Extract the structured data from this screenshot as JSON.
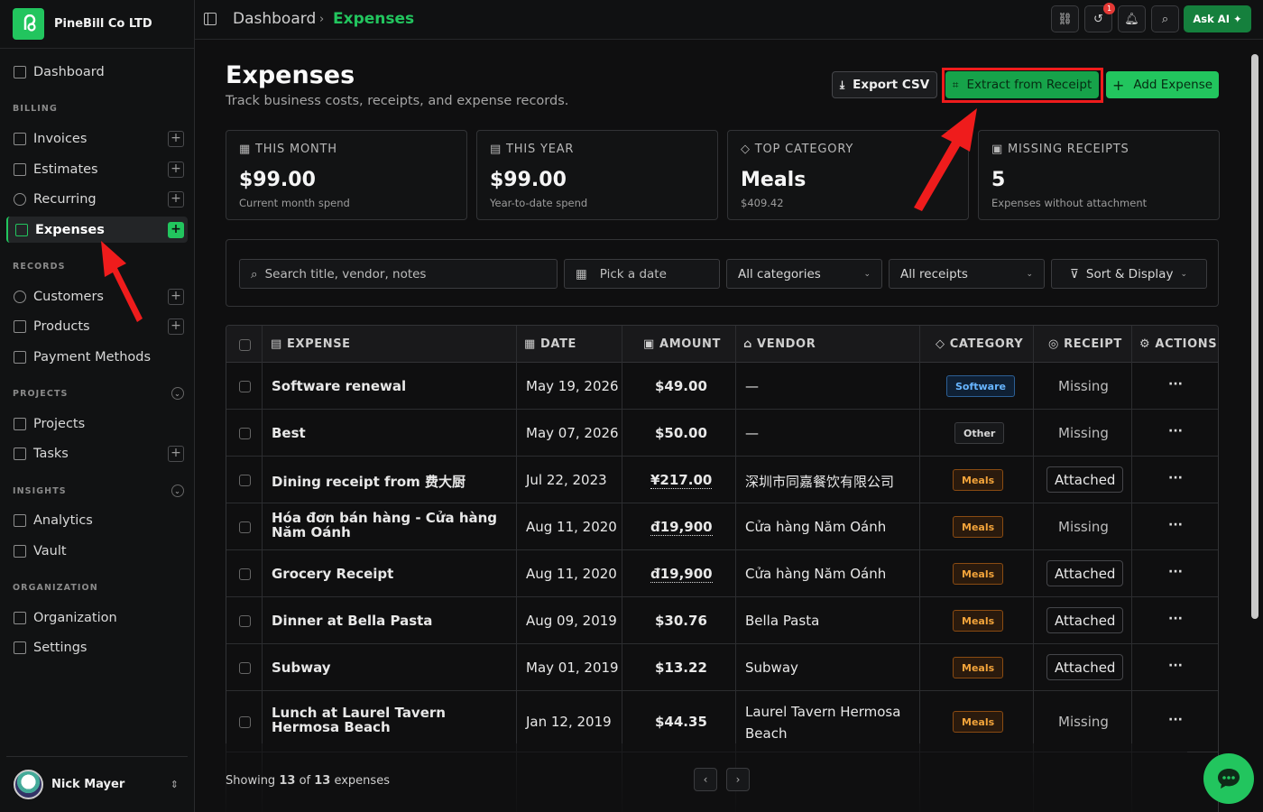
{
  "brand": {
    "name": "PineBill Co LTD"
  },
  "sidebar": {
    "items": [
      {
        "label": "Dashboard",
        "icon": "grid-icon"
      },
      {
        "label": "Invoices",
        "icon": "document-icon"
      },
      {
        "label": "Estimates",
        "icon": "estimate-icon"
      },
      {
        "label": "Recurring",
        "icon": "recurring-icon"
      },
      {
        "label": "Expenses",
        "icon": "expense-icon"
      },
      {
        "label": "Customers",
        "icon": "users-icon"
      },
      {
        "label": "Products",
        "icon": "box-icon"
      },
      {
        "label": "Payment Methods",
        "icon": "card-icon"
      },
      {
        "label": "Projects",
        "icon": "folder-icon"
      },
      {
        "label": "Tasks",
        "icon": "checkbox-icon"
      },
      {
        "label": "Analytics",
        "icon": "chart-icon"
      },
      {
        "label": "Vault",
        "icon": "vault-icon"
      },
      {
        "label": "Organization",
        "icon": "building-icon"
      },
      {
        "label": "Settings",
        "icon": "sliders-icon"
      }
    ],
    "sections": {
      "billing": "BILLING",
      "records": "RECORDS",
      "projects": "PROJECTS",
      "insights": "INSIGHTS",
      "organization": "ORGANIZATION"
    },
    "user": {
      "name": "Nick Mayer"
    }
  },
  "topbar": {
    "breadcrumb": [
      "Dashboard",
      "Expenses"
    ],
    "separator": "›",
    "notification_count": "1",
    "ask_ai": "Ask AI"
  },
  "page": {
    "title": "Expenses",
    "subtitle": "Track business costs, receipts, and expense records.",
    "export_label": "Export CSV",
    "extract_label": "Extract from Receipt",
    "add_label": "Add Expense"
  },
  "cards": [
    {
      "label": "THIS MONTH",
      "value": "$99.00",
      "sub": "Current month spend"
    },
    {
      "label": "THIS YEAR",
      "value": "$99.00",
      "sub": "Year-to-date spend"
    },
    {
      "label": "TOP CATEGORY",
      "value": "Meals",
      "sub": "$409.42"
    },
    {
      "label": "MISSING RECEIPTS",
      "value": "5",
      "sub": "Expenses without attachment"
    }
  ],
  "filters": {
    "search_placeholder": "Search title, vendor, notes",
    "date": "Pick a date",
    "category": "All categories",
    "receipts": "All receipts",
    "sort": "Sort & Display"
  },
  "table": {
    "headers": [
      "EXPENSE",
      "DATE",
      "AMOUNT",
      "VENDOR",
      "CATEGORY",
      "RECEIPT",
      "ACTIONS"
    ],
    "rows": [
      {
        "expense": "Software renewal",
        "date": "May 19, 2026",
        "amount": "$49.00",
        "vendor": "—",
        "category": "Software",
        "receipt": "Missing"
      },
      {
        "expense": "Best",
        "date": "May 07, 2026",
        "amount": "$50.00",
        "vendor": "—",
        "category": "Other",
        "receipt": "Missing"
      },
      {
        "expense": "Dining receipt from 费大厨",
        "date": "Jul 22, 2023",
        "amount": "¥217.00",
        "vendor": "深圳市同嘉餐饮有限公司",
        "category": "Meals",
        "receipt": "Attached"
      },
      {
        "expense": "Hóa đơn bán hàng - Cửa hàng Năm Oánh",
        "date": "Aug 11, 2020",
        "amount": "đ19,900",
        "vendor": "Cửa hàng Năm Oánh",
        "category": "Meals",
        "receipt": "Missing"
      },
      {
        "expense": "Grocery Receipt",
        "date": "Aug 11, 2020",
        "amount": "đ19,900",
        "vendor": "Cửa hàng Năm Oánh",
        "category": "Meals",
        "receipt": "Attached"
      },
      {
        "expense": "Dinner at Bella Pasta",
        "date": "Aug 09, 2019",
        "amount": "$30.76",
        "vendor": "Bella Pasta",
        "category": "Meals",
        "receipt": "Attached"
      },
      {
        "expense": "Subway",
        "date": "May 01, 2019",
        "amount": "$13.22",
        "vendor": "Subway",
        "category": "Meals",
        "receipt": "Attached"
      },
      {
        "expense": "Lunch at Laurel Tavern Hermosa Beach",
        "date": "Jan 12, 2019",
        "amount": "$44.35",
        "vendor": "Laurel Tavern Hermosa Beach",
        "category": "Meals",
        "receipt": "Missing"
      }
    ],
    "actions_glyph": "···"
  },
  "footer": {
    "showing_prefix": "Showing",
    "shown": "13",
    "of": "of",
    "total": "13",
    "suffix": "expenses"
  },
  "colors": {
    "accent": "#22c55e",
    "highlight": "#ef1c1c",
    "meals": "#f2a33a",
    "software": "#67b5ff"
  }
}
